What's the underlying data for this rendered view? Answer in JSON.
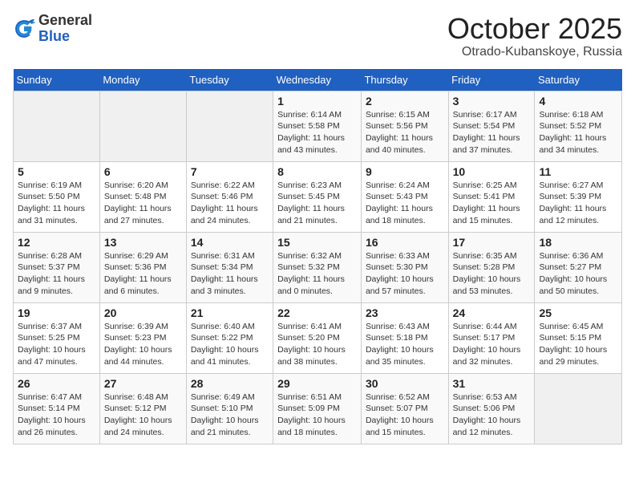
{
  "header": {
    "logo_general": "General",
    "logo_blue": "Blue",
    "month_title": "October 2025",
    "subtitle": "Otrado-Kubanskoye, Russia"
  },
  "days_of_week": [
    "Sunday",
    "Monday",
    "Tuesday",
    "Wednesday",
    "Thursday",
    "Friday",
    "Saturday"
  ],
  "weeks": [
    [
      {
        "day": "",
        "info": ""
      },
      {
        "day": "",
        "info": ""
      },
      {
        "day": "",
        "info": ""
      },
      {
        "day": "1",
        "info": "Sunrise: 6:14 AM\nSunset: 5:58 PM\nDaylight: 11 hours and 43 minutes."
      },
      {
        "day": "2",
        "info": "Sunrise: 6:15 AM\nSunset: 5:56 PM\nDaylight: 11 hours and 40 minutes."
      },
      {
        "day": "3",
        "info": "Sunrise: 6:17 AM\nSunset: 5:54 PM\nDaylight: 11 hours and 37 minutes."
      },
      {
        "day": "4",
        "info": "Sunrise: 6:18 AM\nSunset: 5:52 PM\nDaylight: 11 hours and 34 minutes."
      }
    ],
    [
      {
        "day": "5",
        "info": "Sunrise: 6:19 AM\nSunset: 5:50 PM\nDaylight: 11 hours and 31 minutes."
      },
      {
        "day": "6",
        "info": "Sunrise: 6:20 AM\nSunset: 5:48 PM\nDaylight: 11 hours and 27 minutes."
      },
      {
        "day": "7",
        "info": "Sunrise: 6:22 AM\nSunset: 5:46 PM\nDaylight: 11 hours and 24 minutes."
      },
      {
        "day": "8",
        "info": "Sunrise: 6:23 AM\nSunset: 5:45 PM\nDaylight: 11 hours and 21 minutes."
      },
      {
        "day": "9",
        "info": "Sunrise: 6:24 AM\nSunset: 5:43 PM\nDaylight: 11 hours and 18 minutes."
      },
      {
        "day": "10",
        "info": "Sunrise: 6:25 AM\nSunset: 5:41 PM\nDaylight: 11 hours and 15 minutes."
      },
      {
        "day": "11",
        "info": "Sunrise: 6:27 AM\nSunset: 5:39 PM\nDaylight: 11 hours and 12 minutes."
      }
    ],
    [
      {
        "day": "12",
        "info": "Sunrise: 6:28 AM\nSunset: 5:37 PM\nDaylight: 11 hours and 9 minutes."
      },
      {
        "day": "13",
        "info": "Sunrise: 6:29 AM\nSunset: 5:36 PM\nDaylight: 11 hours and 6 minutes."
      },
      {
        "day": "14",
        "info": "Sunrise: 6:31 AM\nSunset: 5:34 PM\nDaylight: 11 hours and 3 minutes."
      },
      {
        "day": "15",
        "info": "Sunrise: 6:32 AM\nSunset: 5:32 PM\nDaylight: 11 hours and 0 minutes."
      },
      {
        "day": "16",
        "info": "Sunrise: 6:33 AM\nSunset: 5:30 PM\nDaylight: 10 hours and 57 minutes."
      },
      {
        "day": "17",
        "info": "Sunrise: 6:35 AM\nSunset: 5:28 PM\nDaylight: 10 hours and 53 minutes."
      },
      {
        "day": "18",
        "info": "Sunrise: 6:36 AM\nSunset: 5:27 PM\nDaylight: 10 hours and 50 minutes."
      }
    ],
    [
      {
        "day": "19",
        "info": "Sunrise: 6:37 AM\nSunset: 5:25 PM\nDaylight: 10 hours and 47 minutes."
      },
      {
        "day": "20",
        "info": "Sunrise: 6:39 AM\nSunset: 5:23 PM\nDaylight: 10 hours and 44 minutes."
      },
      {
        "day": "21",
        "info": "Sunrise: 6:40 AM\nSunset: 5:22 PM\nDaylight: 10 hours and 41 minutes."
      },
      {
        "day": "22",
        "info": "Sunrise: 6:41 AM\nSunset: 5:20 PM\nDaylight: 10 hours and 38 minutes."
      },
      {
        "day": "23",
        "info": "Sunrise: 6:43 AM\nSunset: 5:18 PM\nDaylight: 10 hours and 35 minutes."
      },
      {
        "day": "24",
        "info": "Sunrise: 6:44 AM\nSunset: 5:17 PM\nDaylight: 10 hours and 32 minutes."
      },
      {
        "day": "25",
        "info": "Sunrise: 6:45 AM\nSunset: 5:15 PM\nDaylight: 10 hours and 29 minutes."
      }
    ],
    [
      {
        "day": "26",
        "info": "Sunrise: 6:47 AM\nSunset: 5:14 PM\nDaylight: 10 hours and 26 minutes."
      },
      {
        "day": "27",
        "info": "Sunrise: 6:48 AM\nSunset: 5:12 PM\nDaylight: 10 hours and 24 minutes."
      },
      {
        "day": "28",
        "info": "Sunrise: 6:49 AM\nSunset: 5:10 PM\nDaylight: 10 hours and 21 minutes."
      },
      {
        "day": "29",
        "info": "Sunrise: 6:51 AM\nSunset: 5:09 PM\nDaylight: 10 hours and 18 minutes."
      },
      {
        "day": "30",
        "info": "Sunrise: 6:52 AM\nSunset: 5:07 PM\nDaylight: 10 hours and 15 minutes."
      },
      {
        "day": "31",
        "info": "Sunrise: 6:53 AM\nSunset: 5:06 PM\nDaylight: 10 hours and 12 minutes."
      },
      {
        "day": "",
        "info": ""
      }
    ]
  ]
}
